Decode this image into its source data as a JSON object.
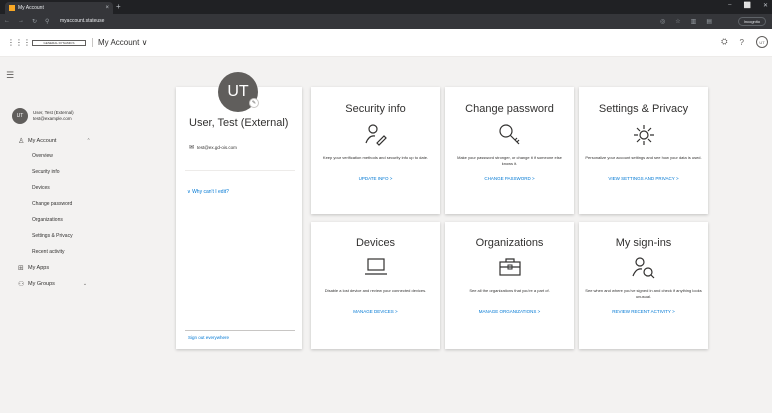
{
  "browser": {
    "tab_title": "My Account",
    "tab_close": "×",
    "new_tab": "+",
    "url": "myaccount.stateuse",
    "incognito": "Incognito",
    "win_min": "–",
    "win_max": "⬜",
    "win_close": "✕"
  },
  "header": {
    "logo_text": "GENERAL DYNAMICS",
    "app_title": "My Account ∨",
    "avatar_initials": "UT"
  },
  "sidebar": {
    "user_initials": "UT",
    "user_name": "User, Test (External)",
    "user_email": "test@example.com",
    "my_account": "My Account",
    "sub_items": [
      "Overview",
      "Security info",
      "Devices",
      "Change password",
      "Organizations",
      "Settings & Privacy",
      "Recent activity"
    ],
    "my_apps": "My Apps",
    "my_groups": "My Groups"
  },
  "profile": {
    "initials": "UT",
    "name": "User, Test (External)",
    "email": "test@ex.gd-ois.com",
    "why_cant_edit": "Why can't I edit?",
    "sign_out": "Sign out everywhere"
  },
  "cards": {
    "security": {
      "title": "Security info",
      "desc": "Keep your verification methods and security info up to date.",
      "link": "UPDATE INFO  >"
    },
    "password": {
      "title": "Change password",
      "desc": "Make your password stronger, or change it if someone else knows it.",
      "link": "CHANGE PASSWORD  >"
    },
    "settings": {
      "title": "Settings & Privacy",
      "desc": "Personalize your account settings and see how your data is used.",
      "link": "VIEW SETTINGS AND PRIVACY  >"
    },
    "devices": {
      "title": "Devices",
      "desc": "Disable a lost device and review your connected devices.",
      "link": "MANAGE DEVICES  >"
    },
    "orgs": {
      "title": "Organizations",
      "desc": "See all the organizations that you're a part of.",
      "link": "MANAGE ORGANIZATIONS  >"
    },
    "signins": {
      "title": "My sign-ins",
      "desc": "See when and where you've signed in and check if anything looks unusual.",
      "link": "REVIEW RECENT ACTIVITY  >"
    }
  }
}
